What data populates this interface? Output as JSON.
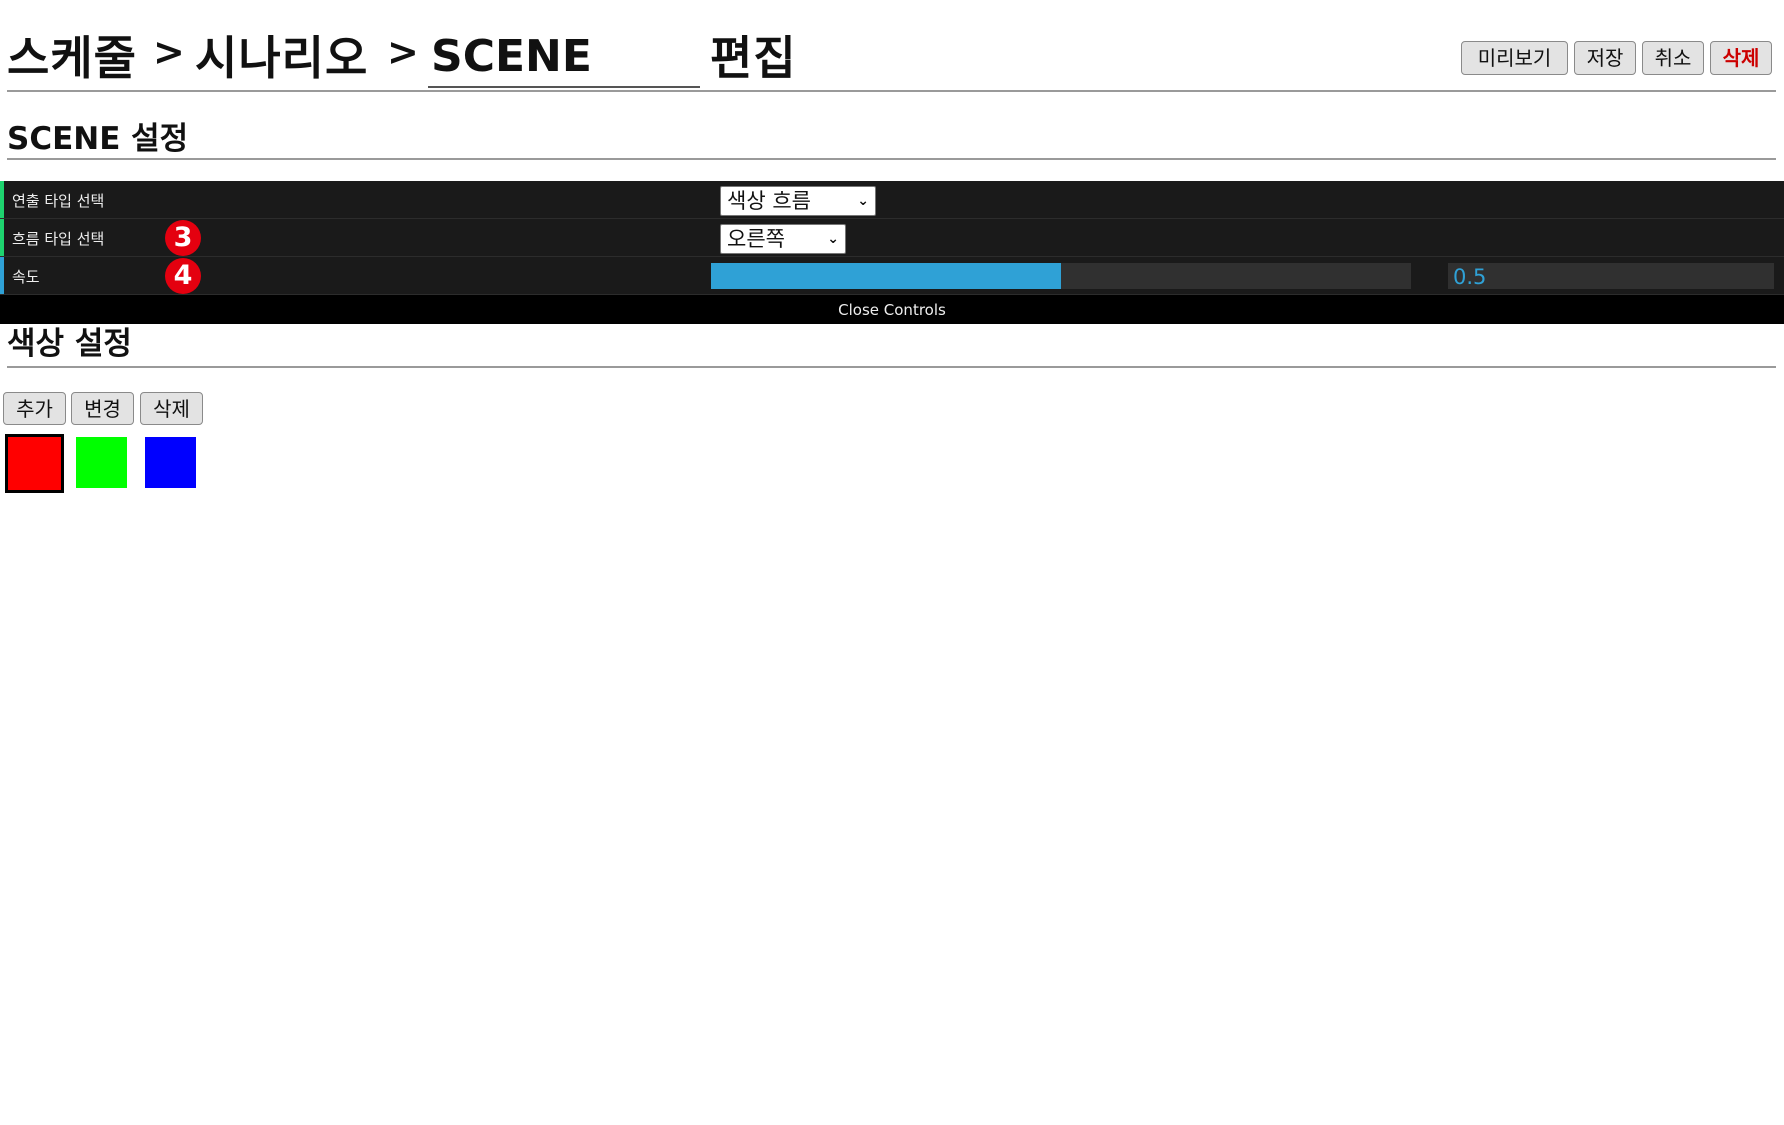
{
  "header": {
    "breadcrumb_schedule": "스케줄",
    "breadcrumb_sep": ">",
    "breadcrumb_scenario": "시나리오",
    "scene_name_value": "SCENE",
    "breadcrumb_edit": "편집",
    "buttons": {
      "preview": "미리보기",
      "save": "저장",
      "cancel": "취소",
      "delete": "삭제"
    },
    "delete_color": "#cc0000"
  },
  "scene_settings": {
    "title": "SCENE 설정"
  },
  "controls": {
    "rows": [
      {
        "label": "연출 타입 선택",
        "value": "색상 흐름",
        "bar_color": "#1ed36f"
      },
      {
        "label": "흐름 타입 선택",
        "value": "오른쪽",
        "bar_color": "#1ed36f",
        "badge": "3"
      },
      {
        "label": "속도",
        "value": "0.5",
        "bar_color": "#2fa1d6",
        "badge": "4",
        "level": 0.5
      }
    ],
    "close_label": "Close Controls",
    "accent": "#2fa1d6"
  },
  "color_settings": {
    "title": "색상 설정",
    "buttons": {
      "add": "추가",
      "change": "변경",
      "delete": "삭제"
    },
    "swatches": [
      {
        "color": "#ff0000",
        "selected": true
      },
      {
        "color": "#00ff00",
        "selected": false
      },
      {
        "color": "#0000ff",
        "selected": false
      }
    ]
  }
}
